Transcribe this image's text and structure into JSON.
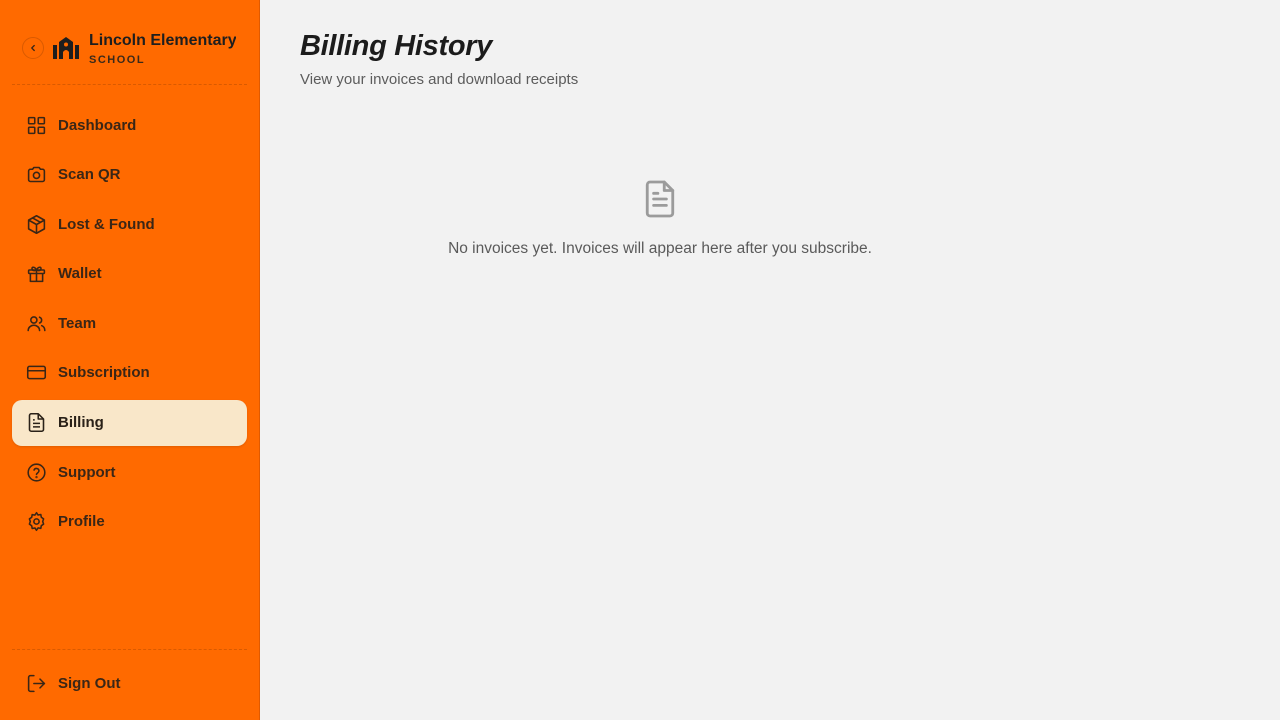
{
  "sidebar": {
    "brand": {
      "name": "Lincoln Elementary",
      "subtitle": "SCHOOL",
      "collapse_icon": "chevron-left-icon",
      "logo_icon": "school-building-icon"
    },
    "items": [
      {
        "label": "Dashboard",
        "icon": "grid-icon"
      },
      {
        "label": "Scan QR",
        "icon": "camera-icon"
      },
      {
        "label": "Lost & Found",
        "icon": "package-icon"
      },
      {
        "label": "Wallet",
        "icon": "gift-icon"
      },
      {
        "label": "Team",
        "icon": "users-icon"
      },
      {
        "label": "Subscription",
        "icon": "credit-card-icon"
      },
      {
        "label": "Billing",
        "icon": "file-text-icon",
        "active": true
      },
      {
        "label": "Support",
        "icon": "help-circle-icon"
      },
      {
        "label": "Profile",
        "icon": "gear-icon"
      }
    ],
    "signout": {
      "label": "Sign Out",
      "icon": "log-out-icon"
    }
  },
  "main": {
    "title": "Billing History",
    "subtitle": "View your invoices and download receipts",
    "empty_state": {
      "icon": "document-icon",
      "message": "No invoices yet. Invoices will appear here after you subscribe."
    }
  },
  "colors": {
    "sidebar_bg": "#ff6a00",
    "active_item_bg": "#f9e7c9",
    "page_bg": "#f2f2f2"
  }
}
